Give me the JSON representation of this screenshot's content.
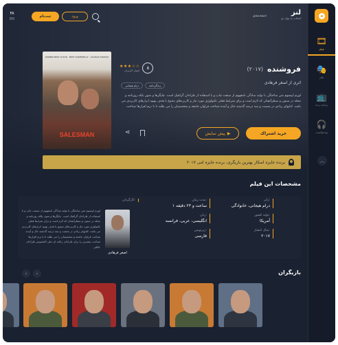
{
  "brand": {
    "name": "لنز",
    "tagline": "انتخاب به توان تو"
  },
  "header": {
    "categories_label": "دسته‌بندی",
    "login_label": "ورود",
    "signup_label": "ثبت‌نام",
    "lang_fa": "FA",
    "lang_en": "EN"
  },
  "sidebar": {
    "items": [
      {
        "label": "فیلم",
        "icon": "film-icon"
      },
      {
        "label": "تئاتر",
        "icon": "theater-icon"
      },
      {
        "label": "برنامه زنده",
        "icon": "tv-icon"
      },
      {
        "label": "ویدئوکست",
        "icon": "podcast-icon"
      }
    ]
  },
  "film": {
    "title": "فروشنده",
    "year": "(۲۰۱۷)",
    "score": "۸",
    "votes": "امتیاز کاربران",
    "director_line": "اثری از اصغر فرهادی",
    "genres": [
      "درام هیجانی",
      "زندگی‌نامه"
    ],
    "synopsis": "لورم ایپسوم متن ساختگی با تولید سادگی نامفهوم از صنعت چاپ و با استفاده از طراحان گرافیک است. چاپگرها و متون بلکه روزنامه و مجله در ستون و سطرآنچنان که لازم است و برای شرایط فعلی تکنولوژی مورد نیاز و کاربردهای متنوع با هدف بهبود ابزارهای کاربردی می باشد. کتابهای زیادی در شصت و سه درصد گذشته حال و آینده شناخت فراوان جامعه و متخصصان را می طلبد تا با نرم افزارها شناخت",
    "subscribe_label": "خرید اشتراک",
    "trailer_label": "پیش نمایش",
    "poster_title": "SALESMAN",
    "poster_text": "WINNER BEST ACTOR · BEST SCREENPLAY · ASGHAR FARHADI"
  },
  "award": {
    "text": "برنده جایزه اسکار بهترین بازیگری، برنده جایزه امی ۲۰۱۷"
  },
  "specs": {
    "title": "مشخصات این فیلم",
    "genre_label": "ژانر:",
    "genre_value": "درام هیجانی، خانوادگی",
    "country_label": "تولید کشور:",
    "country_value": "آمریکا",
    "year_label": "سال انتشار:",
    "year_value": "۲۰۱۷",
    "duration_label": "مدت زمان:",
    "duration_value": "۱ ساعت و ۲۳ دقیقه",
    "language_label": "زبان:",
    "language_value": "انگلیسی، عربی، فرانسه",
    "subtitle_label": "زیرنویس:",
    "subtitle_value": "فارسی",
    "director_label": "کارگردان:",
    "director_name": "اصغر فرهادی",
    "director_bio": "لورم ایپسوم متن ساختگی با تولید سادگی نامفهوم از صنعت چاپ و با استفاده از طراحان گرافیک است. چاپگرها و متون بلکه روزنامه و مجله در ستون و سطرآنچنان که لازم است و برای شرایط فعلی تکنولوژی مورد نیاز و کاربردهای متنوع با هدف بهبود ابزارهای کاربردی می باشد. کتابهای زیادی در شصت و سه درصد گذشته حال و آینده شناخت فراوان جامعه و متخصصان را می طلبد تا با نرم افزارها شناخت بیشتری را برای طراحان رایانه ای علی الخصوص طراحان خلاقی"
  },
  "cast": {
    "title": "بازیگران",
    "cards": [
      {
        "bg": "#5f6f86",
        "body": "#2e3440"
      },
      {
        "bg": "#c87a34",
        "body": "#4c5a3c"
      },
      {
        "bg": "#a12a28",
        "body": "#3a3e46"
      },
      {
        "bg": "#6a7280",
        "body": "#2b2f38"
      },
      {
        "bg": "#c87a34",
        "body": "#4c5a3c"
      },
      {
        "bg": "#5f6f86",
        "body": "#2e3440"
      }
    ]
  },
  "colors": {
    "accent": "#f5a623",
    "background": "#1a2130",
    "award": "#c8a548"
  }
}
